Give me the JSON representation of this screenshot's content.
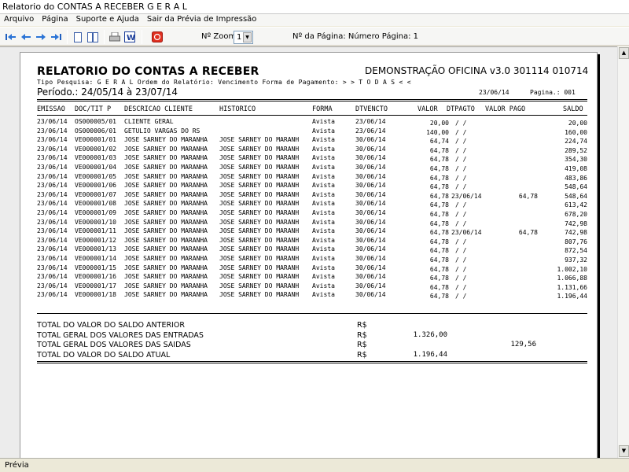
{
  "window": {
    "title": "Relatorio do CONTAS A RECEBER G E R A L"
  },
  "menu": [
    "Arquivo",
    "Página",
    "Suporte e Ajuda",
    "Sair da Prévia de Impressão"
  ],
  "toolbar": {
    "zoom_label": "Nº Zoom",
    "zoom_value": "1",
    "page_info": "Nº da Página: Número Página: 1"
  },
  "report": {
    "title": "RELATORIO DO CONTAS A RECEBER",
    "demo": "DEMONSTRAÇÃO OFICINA v3.0 301114 010714",
    "filter_line": "Tipo Pesquisa: G E R A L   Ordem do Relatório: Vencimento   Forma de Pagamento: > > T O D A S < <",
    "period": "Período.: 24/05/14 à 23/07/14",
    "date": "23/06/14",
    "page": "Pagina.: 001",
    "headers": {
      "emissao": "EMISSAO",
      "doc": "DOC/TIT P",
      "descricao": "DESCRICAO CLIENTE",
      "historico": "HISTORICO",
      "forma": "FORMA",
      "dtvencto": "DTVENCTO",
      "valor": "VALOR",
      "dtpagto": "DTPAGTO",
      "valor_pago": "VALOR PAGO",
      "saldo": "SALDO"
    },
    "rows": [
      {
        "emissao": "23/06/14",
        "doc": "OS000005/01",
        "descricao": "CLIENTE GERAL",
        "historico": "",
        "forma": "Avista",
        "dtvencto": "23/06/14",
        "valor": "20,00",
        "dtpagto": "/  /",
        "valor_pago": "",
        "saldo": "20,00"
      },
      {
        "emissao": "23/06/14",
        "doc": "OS000006/01",
        "descricao": "GETULIO VARGAS DO RS",
        "historico": "",
        "forma": "Avista",
        "dtvencto": "23/06/14",
        "valor": "140,00",
        "dtpagto": "/  /",
        "valor_pago": "",
        "saldo": "160,00"
      },
      {
        "emissao": "23/06/14",
        "doc": "VE000001/01",
        "descricao": "JOSE SARNEY DO MARANHA",
        "historico": "JOSE SARNEY DO MARANH",
        "forma": "Avista",
        "dtvencto": "30/06/14",
        "valor": "64,74",
        "dtpagto": "/  /",
        "valor_pago": "",
        "saldo": "224,74"
      },
      {
        "emissao": "23/06/14",
        "doc": "VE000001/02",
        "descricao": "JOSE SARNEY DO MARANHA",
        "historico": "JOSE SARNEY DO MARANH",
        "forma": "Avista",
        "dtvencto": "30/06/14",
        "valor": "64,78",
        "dtpagto": "/  /",
        "valor_pago": "",
        "saldo": "289,52"
      },
      {
        "emissao": "23/06/14",
        "doc": "VE000001/03",
        "descricao": "JOSE SARNEY DO MARANHA",
        "historico": "JOSE SARNEY DO MARANH",
        "forma": "Avista",
        "dtvencto": "30/06/14",
        "valor": "64,78",
        "dtpagto": "/  /",
        "valor_pago": "",
        "saldo": "354,30"
      },
      {
        "emissao": "23/06/14",
        "doc": "VE000001/04",
        "descricao": "JOSE SARNEY DO MARANHA",
        "historico": "JOSE SARNEY DO MARANH",
        "forma": "Avista",
        "dtvencto": "30/06/14",
        "valor": "64,78",
        "dtpagto": "/  /",
        "valor_pago": "",
        "saldo": "419,08"
      },
      {
        "emissao": "23/06/14",
        "doc": "VE000001/05",
        "descricao": "JOSE SARNEY DO MARANHA",
        "historico": "JOSE SARNEY DO MARANH",
        "forma": "Avista",
        "dtvencto": "30/06/14",
        "valor": "64,78",
        "dtpagto": "/  /",
        "valor_pago": "",
        "saldo": "483,86"
      },
      {
        "emissao": "23/06/14",
        "doc": "VE000001/06",
        "descricao": "JOSE SARNEY DO MARANHA",
        "historico": "JOSE SARNEY DO MARANH",
        "forma": "Avista",
        "dtvencto": "30/06/14",
        "valor": "64,78",
        "dtpagto": "/  /",
        "valor_pago": "",
        "saldo": "548,64"
      },
      {
        "emissao": "23/06/14",
        "doc": "VE000001/07",
        "descricao": "JOSE SARNEY DO MARANHA",
        "historico": "JOSE SARNEY DO MARANH",
        "forma": "Avista",
        "dtvencto": "30/06/14",
        "valor": "64,78",
        "dtpagto": "23/06/14",
        "valor_pago": "64,78",
        "saldo": "548,64"
      },
      {
        "emissao": "23/06/14",
        "doc": "VE000001/08",
        "descricao": "JOSE SARNEY DO MARANHA",
        "historico": "JOSE SARNEY DO MARANH",
        "forma": "Avista",
        "dtvencto": "30/06/14",
        "valor": "64,78",
        "dtpagto": "/  /",
        "valor_pago": "",
        "saldo": "613,42"
      },
      {
        "emissao": "23/06/14",
        "doc": "VE000001/09",
        "descricao": "JOSE SARNEY DO MARANHA",
        "historico": "JOSE SARNEY DO MARANH",
        "forma": "Avista",
        "dtvencto": "30/06/14",
        "valor": "64,78",
        "dtpagto": "/  /",
        "valor_pago": "",
        "saldo": "678,20"
      },
      {
        "emissao": "23/06/14",
        "doc": "VE000001/10",
        "descricao": "JOSE SARNEY DO MARANHA",
        "historico": "JOSE SARNEY DO MARANH",
        "forma": "Avista",
        "dtvencto": "30/06/14",
        "valor": "64,78",
        "dtpagto": "/  /",
        "valor_pago": "",
        "saldo": "742,98"
      },
      {
        "emissao": "23/06/14",
        "doc": "VE000001/11",
        "descricao": "JOSE SARNEY DO MARANHA",
        "historico": "JOSE SARNEY DO MARANH",
        "forma": "Avista",
        "dtvencto": "30/06/14",
        "valor": "64,78",
        "dtpagto": "23/06/14",
        "valor_pago": "64,78",
        "saldo": "742,98"
      },
      {
        "emissao": "23/06/14",
        "doc": "VE000001/12",
        "descricao": "JOSE SARNEY DO MARANHA",
        "historico": "JOSE SARNEY DO MARANH",
        "forma": "Avista",
        "dtvencto": "30/06/14",
        "valor": "64,78",
        "dtpagto": "/  /",
        "valor_pago": "",
        "saldo": "807,76"
      },
      {
        "emissao": "23/06/14",
        "doc": "VE000001/13",
        "descricao": "JOSE SARNEY DO MARANHA",
        "historico": "JOSE SARNEY DO MARANH",
        "forma": "Avista",
        "dtvencto": "30/06/14",
        "valor": "64,78",
        "dtpagto": "/  /",
        "valor_pago": "",
        "saldo": "872,54"
      },
      {
        "emissao": "23/06/14",
        "doc": "VE000001/14",
        "descricao": "JOSE SARNEY DO MARANHA",
        "historico": "JOSE SARNEY DO MARANH",
        "forma": "Avista",
        "dtvencto": "30/06/14",
        "valor": "64,78",
        "dtpagto": "/  /",
        "valor_pago": "",
        "saldo": "937,32"
      },
      {
        "emissao": "23/06/14",
        "doc": "VE000001/15",
        "descricao": "JOSE SARNEY DO MARANHA",
        "historico": "JOSE SARNEY DO MARANH",
        "forma": "Avista",
        "dtvencto": "30/06/14",
        "valor": "64,78",
        "dtpagto": "/  /",
        "valor_pago": "",
        "saldo": "1.002,10"
      },
      {
        "emissao": "23/06/14",
        "doc": "VE000001/16",
        "descricao": "JOSE SARNEY DO MARANHA",
        "historico": "JOSE SARNEY DO MARANH",
        "forma": "Avista",
        "dtvencto": "30/06/14",
        "valor": "64,78",
        "dtpagto": "/  /",
        "valor_pago": "",
        "saldo": "1.066,88"
      },
      {
        "emissao": "23/06/14",
        "doc": "VE000001/17",
        "descricao": "JOSE SARNEY DO MARANHA",
        "historico": "JOSE SARNEY DO MARANH",
        "forma": "Avista",
        "dtvencto": "30/06/14",
        "valor": "64,78",
        "dtpagto": "/  /",
        "valor_pago": "",
        "saldo": "1.131,66"
      },
      {
        "emissao": "23/06/14",
        "doc": "VE000001/18",
        "descricao": "JOSE SARNEY DO MARANHA",
        "historico": "JOSE SARNEY DO MARANH",
        "forma": "Avista",
        "dtvencto": "30/06/14",
        "valor": "64,78",
        "dtpagto": "/  /",
        "valor_pago": "",
        "saldo": "1.196,44"
      }
    ],
    "totals": [
      {
        "label": "TOTAL DO VALOR DO SALDO ANTERIOR",
        "currency": "R$",
        "value": "",
        "paid": ""
      },
      {
        "label": "TOTAL GERAL DOS VALORES DAS ENTRADAS",
        "currency": "R$",
        "value": "1.326,00",
        "paid": ""
      },
      {
        "label": "TOTAL GERAL DOS VALORES DAS SAIDAS",
        "currency": "R$",
        "value": "",
        "paid": "129,56"
      },
      {
        "label": "TOTAL DO VALOR DO SALDO ATUAL",
        "currency": "R$",
        "value": "1.196,44",
        "paid": ""
      }
    ]
  },
  "status": {
    "text": "Prévia"
  }
}
